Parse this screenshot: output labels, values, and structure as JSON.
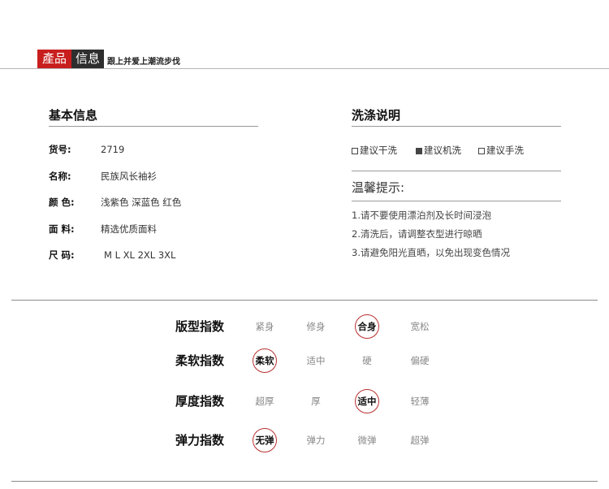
{
  "header": {
    "tag_red": "產品",
    "tag_dark": "信息",
    "slogan": "跟上并爱上潮流步伐"
  },
  "basic_info": {
    "title": "基本信息",
    "rows": [
      {
        "label": "货号:",
        "value": "2719"
      },
      {
        "label": "名称:",
        "value": "民族风长袖衫"
      },
      {
        "label": "颜 色:",
        "value": "浅紫色 深蓝色 红色"
      },
      {
        "label": "面 料:",
        "value": "精选优质面料"
      },
      {
        "label": "尺 码:",
        "value": "M L XL 2XL 3XL"
      }
    ]
  },
  "wash": {
    "title": "洗涤说明",
    "options": [
      {
        "label": "建议干洗",
        "checked": false
      },
      {
        "label": "建议机洗",
        "checked": true
      },
      {
        "label": "建议手洗",
        "checked": false
      }
    ],
    "tips_title": "温馨提示:",
    "tips": [
      "1.请不要使用漂泊剂及长时间浸泡",
      "2.清洗后，请调整衣型进行晾晒",
      "3.请避免阳光直晒，以免出现变色情况"
    ]
  },
  "fit_indices": [
    {
      "label": "版型指数",
      "options": [
        "紧身",
        "修身",
        "合身",
        "宽松"
      ],
      "selected": 2
    },
    {
      "label": "柔软指数",
      "options": [
        "柔软",
        "适中",
        "硬",
        "偏硬"
      ],
      "selected": 0
    },
    {
      "label": "厚度指数",
      "options": [
        "超厚",
        "厚",
        "适中",
        "轻薄"
      ],
      "selected": 2
    },
    {
      "label": "弹力指数",
      "options": [
        "无弹",
        "弹力",
        "微弹",
        "超弹"
      ],
      "selected": 0
    }
  ],
  "colors": {
    "accent_red": "#c81e1e",
    "dark": "#2e2e2e",
    "ring": "#b83030"
  }
}
